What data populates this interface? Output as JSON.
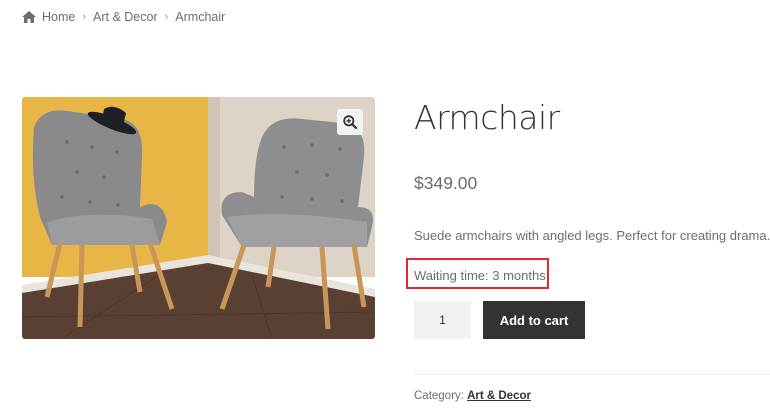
{
  "breadcrumb": {
    "home": "Home",
    "category": "Art & Decor",
    "current": "Armchair"
  },
  "icons": {
    "home": "home-icon",
    "separator": "chevron-right-icon",
    "zoom": "zoom-in-icon"
  },
  "product": {
    "title": "Armchair",
    "price": "$349.00",
    "description": "Suede armchairs with angled legs. Perfect for creating drama.",
    "waiting_time": "Waiting time: 3 months",
    "quantity": "1",
    "add_to_cart_label": "Add to cart",
    "category_label": "Category:",
    "category": "Art & Decor"
  },
  "colors": {
    "button_bg": "#333333",
    "highlight_border": "#e0282e",
    "wall_yellow": "#e8b646"
  }
}
